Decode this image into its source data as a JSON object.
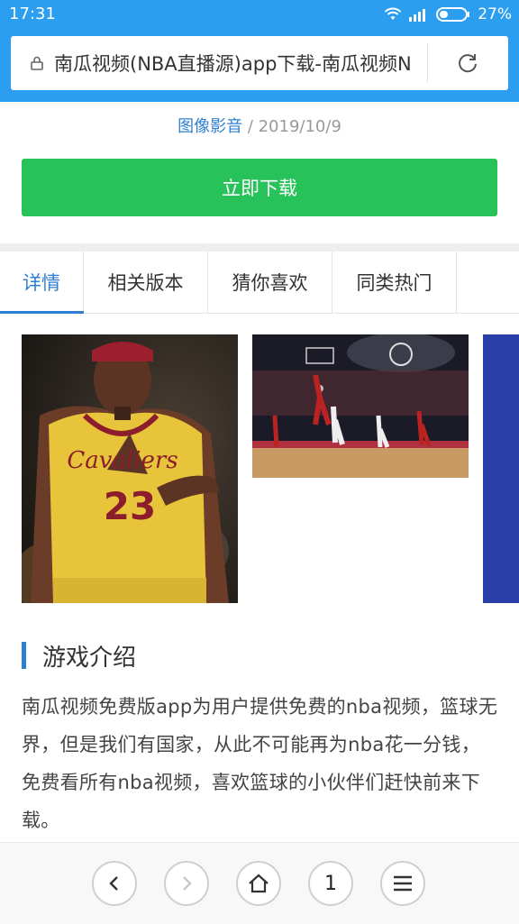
{
  "status": {
    "time": "17:31",
    "battery": "27%"
  },
  "url_bar": {
    "url": "南瓜视频(NBA直播源)app下载-南瓜视频N"
  },
  "meta": {
    "category": "图像影音",
    "sep": " / ",
    "date": "2019/10/9"
  },
  "download_button": "立即下载",
  "tabs": [
    {
      "label": "详情"
    },
    {
      "label": "相关版本"
    },
    {
      "label": "猜你喜欢"
    },
    {
      "label": "同类热门"
    }
  ],
  "section": {
    "title": "游戏介绍"
  },
  "description": "南瓜视频免费版app为用户提供免费的nba视频，篮球无界，但是我们有国家，从此不可能再为nba花一分钱，免费看所有nba视频，喜欢篮球的小伙伴们赶快前来下载。",
  "bottom_nav": {
    "page_count": "1"
  },
  "jersey": {
    "team": "Cavaliers",
    "number": "23"
  },
  "colors": {
    "accent": "#2c9ef0",
    "download": "#27c35a",
    "tab_active": "#2f7fd1"
  }
}
